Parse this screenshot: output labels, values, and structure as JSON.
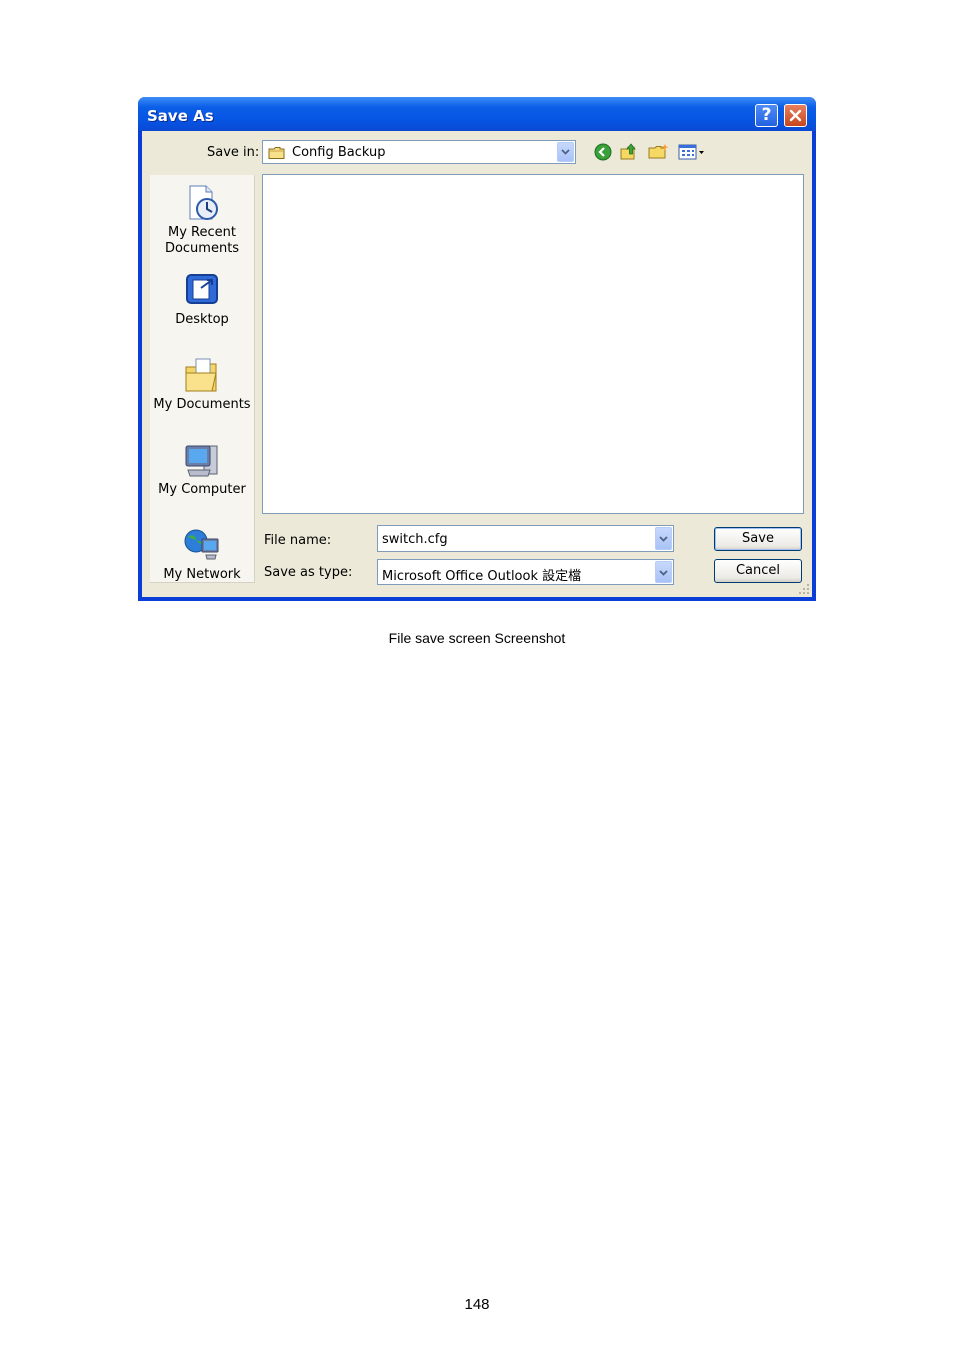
{
  "dialog": {
    "title": "Save As",
    "help_label": "?",
    "close_label": "✕"
  },
  "toolbar": {
    "save_in_label": "Save in:",
    "save_in_value": "Config Backup"
  },
  "places": [
    {
      "label_line1": "My Recent",
      "label_line2": "Documents",
      "icon": "recent-documents-icon"
    },
    {
      "label_line1": "Desktop",
      "label_line2": "",
      "icon": "desktop-icon"
    },
    {
      "label_line1": "My Documents",
      "label_line2": "",
      "icon": "my-documents-icon"
    },
    {
      "label_line1": "My Computer",
      "label_line2": "",
      "icon": "my-computer-icon"
    },
    {
      "label_line1": "My Network",
      "label_line2": "",
      "icon": "my-network-icon"
    }
  ],
  "form": {
    "file_name_label": "File name:",
    "file_name_value": "switch.cfg",
    "save_as_type_label": "Save as type:",
    "save_as_type_value": "Microsoft Office Outlook 設定檔"
  },
  "buttons": {
    "save": "Save",
    "cancel": "Cancel"
  },
  "page": {
    "caption": "File save screen Screenshot",
    "page_number": "148"
  }
}
